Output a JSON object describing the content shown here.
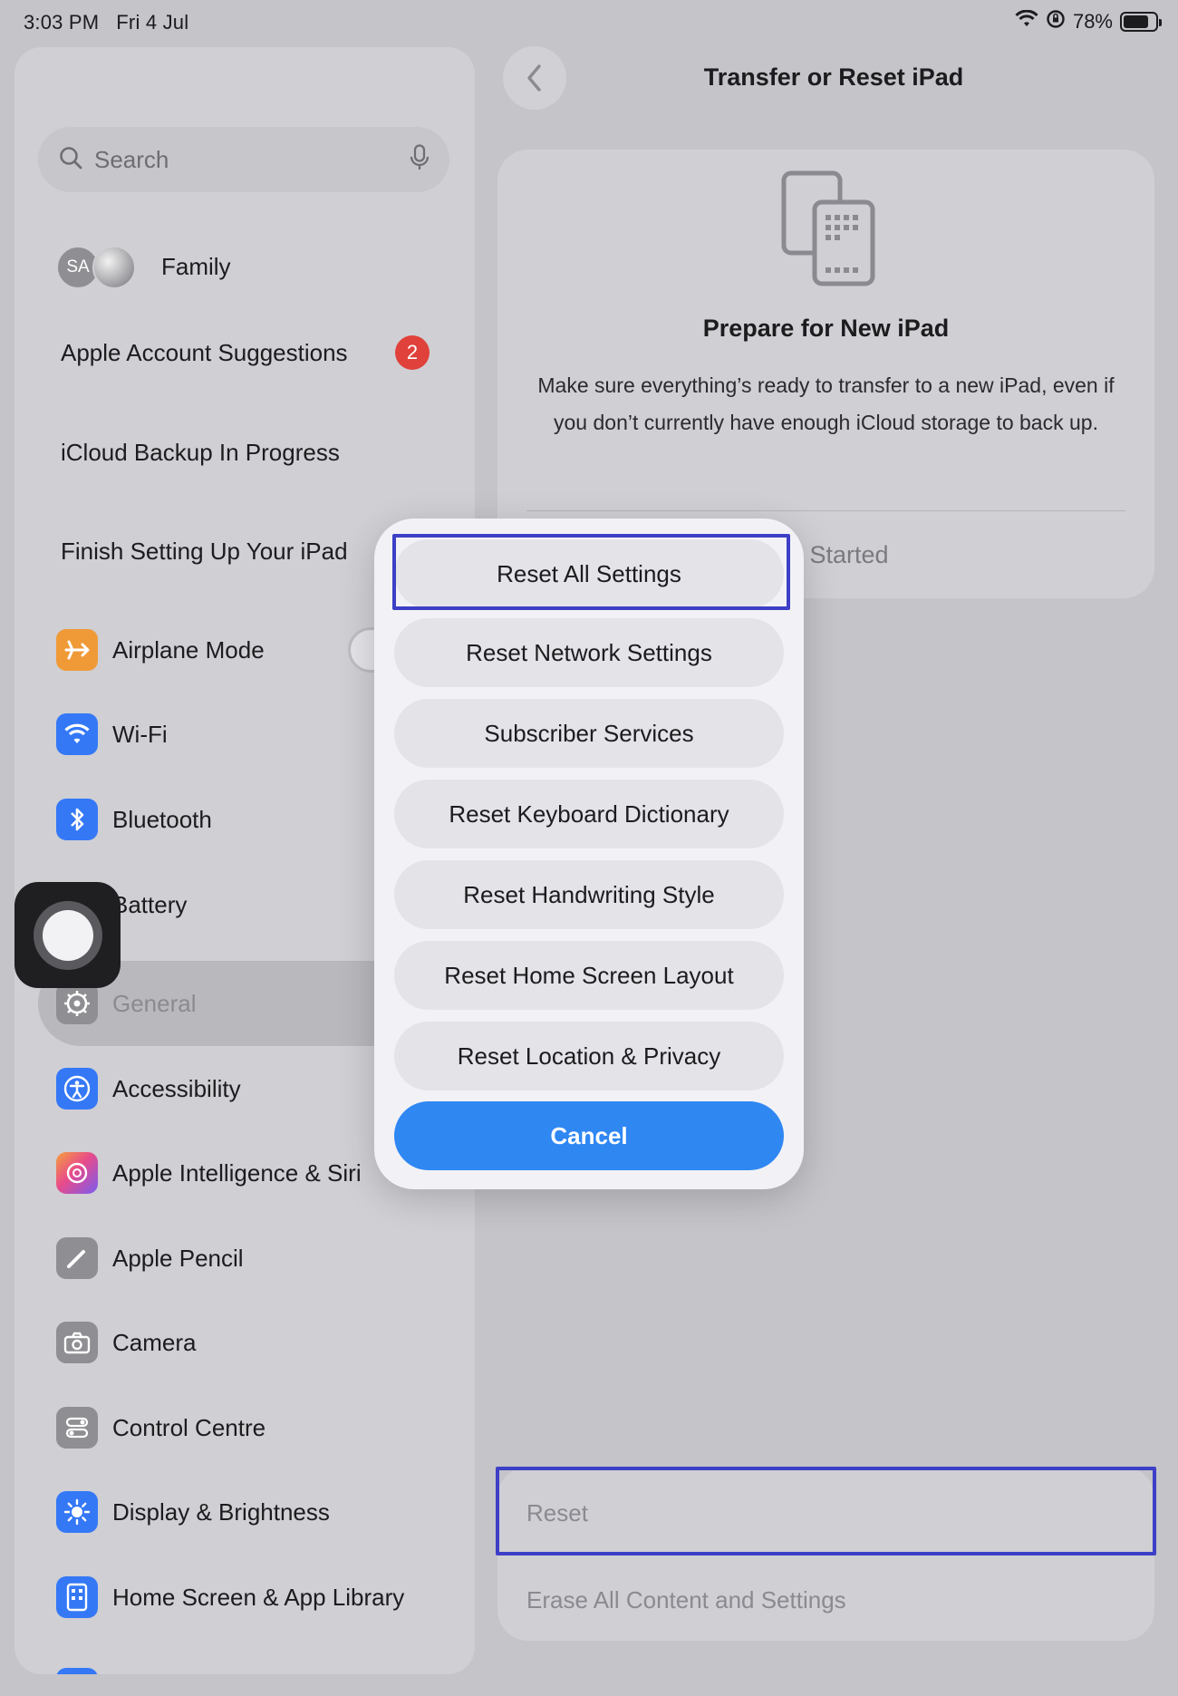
{
  "status_bar": {
    "time": "3:03 PM",
    "date": "Fri 4 Jul",
    "battery_percent": "78%",
    "battery_level": 0.78
  },
  "sidebar": {
    "search_placeholder": "Search",
    "family_label": "Family",
    "avatar_initials": "SA",
    "suggestions_label": "Apple Account Suggestions",
    "suggestions_badge": "2",
    "icloud_label": "iCloud Backup In Progress",
    "finish_label": "Finish Setting Up Your iPad",
    "items": [
      {
        "label": "Airplane Mode",
        "icon": "airplane-icon",
        "color": "#f09a37"
      },
      {
        "label": "Wi-Fi",
        "icon": "wifi-icon",
        "color": "#3478f6"
      },
      {
        "label": "Bluetooth",
        "icon": "bluetooth-icon",
        "color": "#3478f6"
      },
      {
        "label": "Battery",
        "icon": "battery-icon",
        "color": "#4cd964"
      },
      {
        "label": "General",
        "icon": "gear-icon",
        "color": "#8e8e93"
      },
      {
        "label": "Accessibility",
        "icon": "accessibility-icon",
        "color": "#3478f6"
      },
      {
        "label": "Apple Intelligence & Siri",
        "icon": "siri-icon",
        "color": "#b35cf0"
      },
      {
        "label": "Apple Pencil",
        "icon": "pencil-icon",
        "color": "#8e8e93"
      },
      {
        "label": "Camera",
        "icon": "camera-icon",
        "color": "#8e8e93"
      },
      {
        "label": "Control Centre",
        "icon": "control-centre-icon",
        "color": "#8e8e93"
      },
      {
        "label": "Display & Brightness",
        "icon": "sun-icon",
        "color": "#3478f6"
      },
      {
        "label": "Home Screen & App Library",
        "icon": "home-screen-icon",
        "color": "#3478f6"
      }
    ]
  },
  "detail": {
    "nav_title": "Transfer or Reset iPad",
    "prepare_title": "Prepare for New iPad",
    "prepare_desc": "Make sure everything’s ready to transfer to a new iPad, even if you don’t currently have enough iCloud storage to back up.",
    "get_started": "Get Started",
    "reset_label": "Reset",
    "erase_label": "Erase All Content and Settings"
  },
  "action_menu": {
    "options": [
      "Reset All Settings",
      "Reset Network Settings",
      "Subscriber Services",
      "Reset Keyboard Dictionary",
      "Reset Handwriting Style",
      "Reset Home Screen Layout",
      "Reset Location & Privacy"
    ],
    "cancel_label": "Cancel",
    "accent_color": "#2f87f2",
    "highlight_color": "#3d3fc6"
  }
}
